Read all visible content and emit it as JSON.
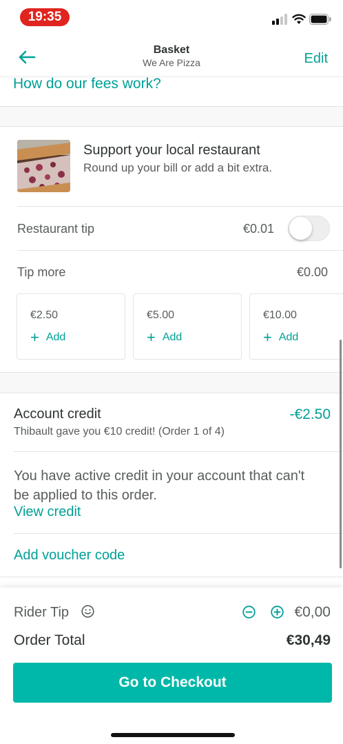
{
  "status_bar": {
    "time": "19:35"
  },
  "header": {
    "title": "Basket",
    "subtitle": "We Are Pizza",
    "edit_label": "Edit"
  },
  "fees_link": "How do our fees work?",
  "support": {
    "title": "Support your local restaurant",
    "subtitle": "Round up your bill or add a bit extra."
  },
  "restaurant_tip": {
    "label": "Restaurant tip",
    "value": "€0.01",
    "toggle_on": false
  },
  "tip_more": {
    "label": "Tip more",
    "value": "€0.00",
    "options": [
      {
        "amount": "€2.50",
        "add_label": "Add"
      },
      {
        "amount": "€5.00",
        "add_label": "Add"
      },
      {
        "amount": "€10.00",
        "add_label": "Add"
      }
    ]
  },
  "account_credit": {
    "title": "Account credit",
    "amount": "-€2.50",
    "subtitle": "Thibault gave you €10 credit! (Order 1 of 4)"
  },
  "active_credit": {
    "text": "You have active credit in your account that can't be applied to this order.",
    "link": "View credit"
  },
  "voucher_link": "Add voucher code",
  "rider_tip": {
    "label": "Rider Tip",
    "value": "€0,00"
  },
  "order_total": {
    "label": "Order Total",
    "value": "€30,49"
  },
  "checkout_button": "Go to Checkout",
  "colors": {
    "accent": "#00a096",
    "button": "#00b8a9",
    "time_pill": "#e0241f"
  }
}
